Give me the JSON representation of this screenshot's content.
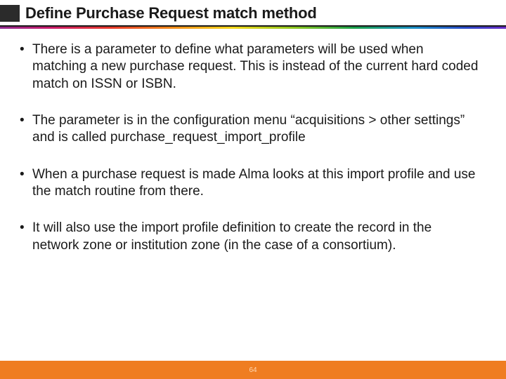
{
  "title": "Define Purchase Request match method",
  "bullets": [
    "There is a parameter to define what parameters will be used when matching a new purchase request. This is instead of the current hard coded match on ISSN or ISBN.",
    "The parameter is in the configuration menu “acquisitions > other settings” and is called purchase_request_import_profile",
    "When a purchase request is made Alma looks at this import profile and use the match routine from there.",
    "It will also use the import profile definition to create the record in the network zone or institution zone (in the case of a consortium)."
  ],
  "page_number": "64"
}
